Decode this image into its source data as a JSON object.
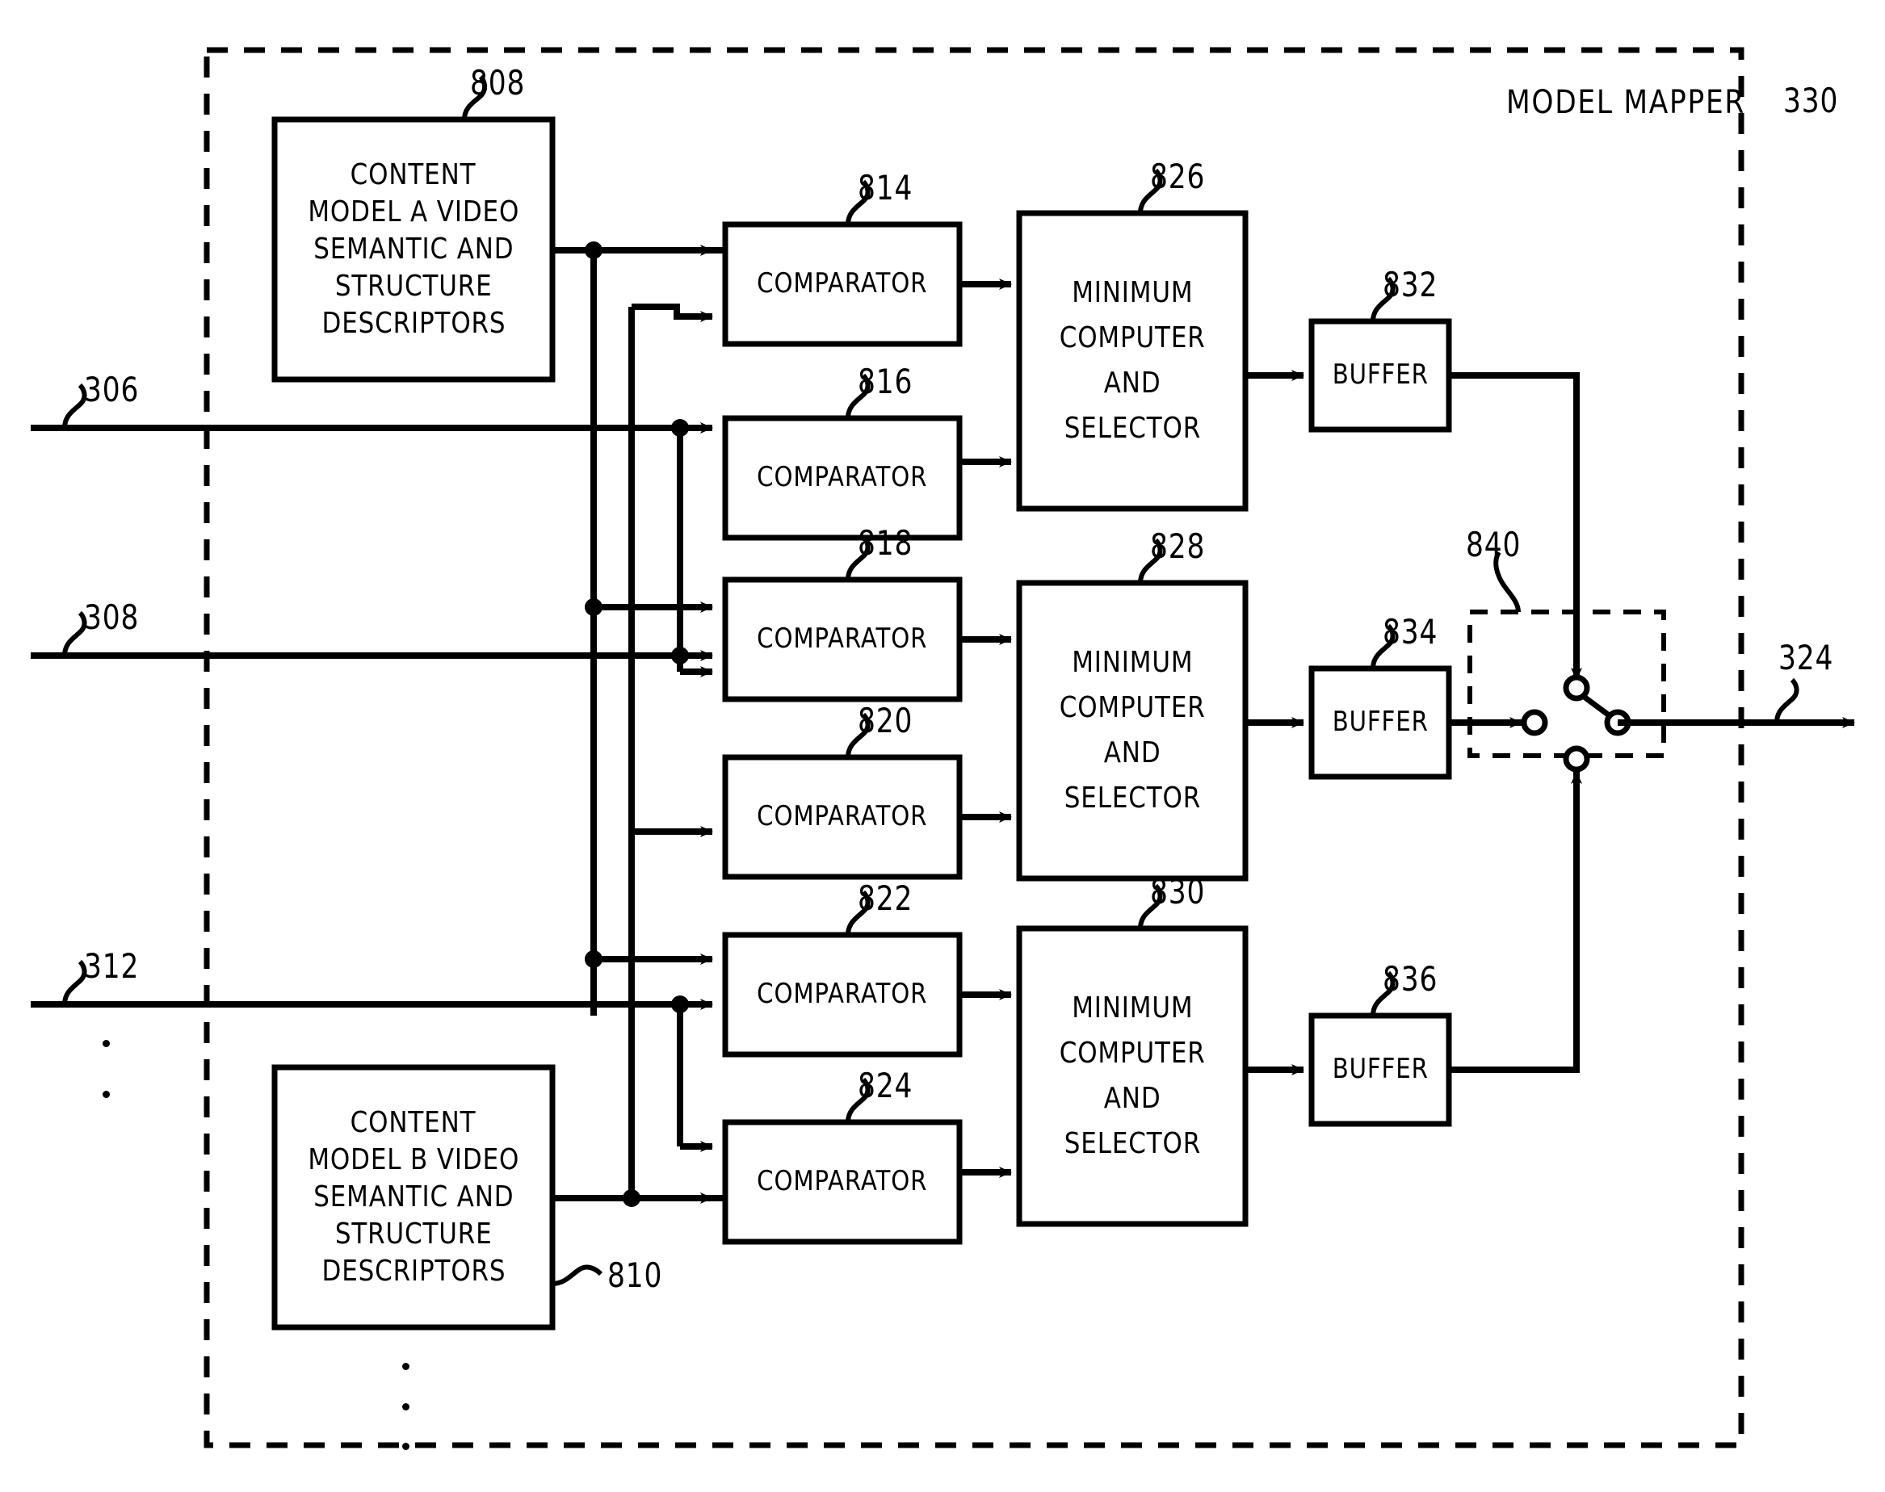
{
  "figure": {
    "title": "MODEL MAPPER",
    "title_ref": "330",
    "type": "patent-block-diagram"
  },
  "frame": {
    "label": "MODEL MAPPER",
    "ref": "330"
  },
  "inputs": [
    {
      "ref": "306",
      "label": "306"
    },
    {
      "ref": "308",
      "label": "308"
    },
    {
      "ref": "312",
      "label": "312"
    }
  ],
  "output": {
    "ref": "324",
    "label": "324"
  },
  "descriptor_blocks": [
    {
      "ref": "808",
      "lines": [
        "CONTENT",
        "MODEL A VIDEO",
        "SEMANTIC AND",
        "STRUCTURE",
        "DESCRIPTORS"
      ]
    },
    {
      "ref": "810",
      "lines": [
        "CONTENT",
        "MODEL B VIDEO",
        "SEMANTIC AND",
        "STRUCTURE",
        "DESCRIPTORS"
      ]
    }
  ],
  "comparators": [
    {
      "ref": "814",
      "label": "COMPARATOR"
    },
    {
      "ref": "816",
      "label": "COMPARATOR"
    },
    {
      "ref": "818",
      "label": "COMPARATOR"
    },
    {
      "ref": "820",
      "label": "COMPARATOR"
    },
    {
      "ref": "822",
      "label": "COMPARATOR"
    },
    {
      "ref": "824",
      "label": "COMPARATOR"
    }
  ],
  "minimum_selectors": [
    {
      "ref": "826",
      "lines": [
        "MINIMUM",
        "COMPUTER",
        "AND",
        "SELECTOR"
      ]
    },
    {
      "ref": "828",
      "lines": [
        "MINIMUM",
        "COMPUTER",
        "AND",
        "SELECTOR"
      ]
    },
    {
      "ref": "830",
      "lines": [
        "MINIMUM",
        "COMPUTER",
        "AND",
        "SELECTOR"
      ]
    }
  ],
  "buffers": [
    {
      "ref": "832",
      "label": "BUFFER"
    },
    {
      "ref": "834",
      "label": "BUFFER"
    },
    {
      "ref": "836",
      "label": "BUFFER"
    }
  ],
  "switch": {
    "ref": "840"
  },
  "colors": {
    "line": "#000000",
    "background": "#ffffff"
  }
}
